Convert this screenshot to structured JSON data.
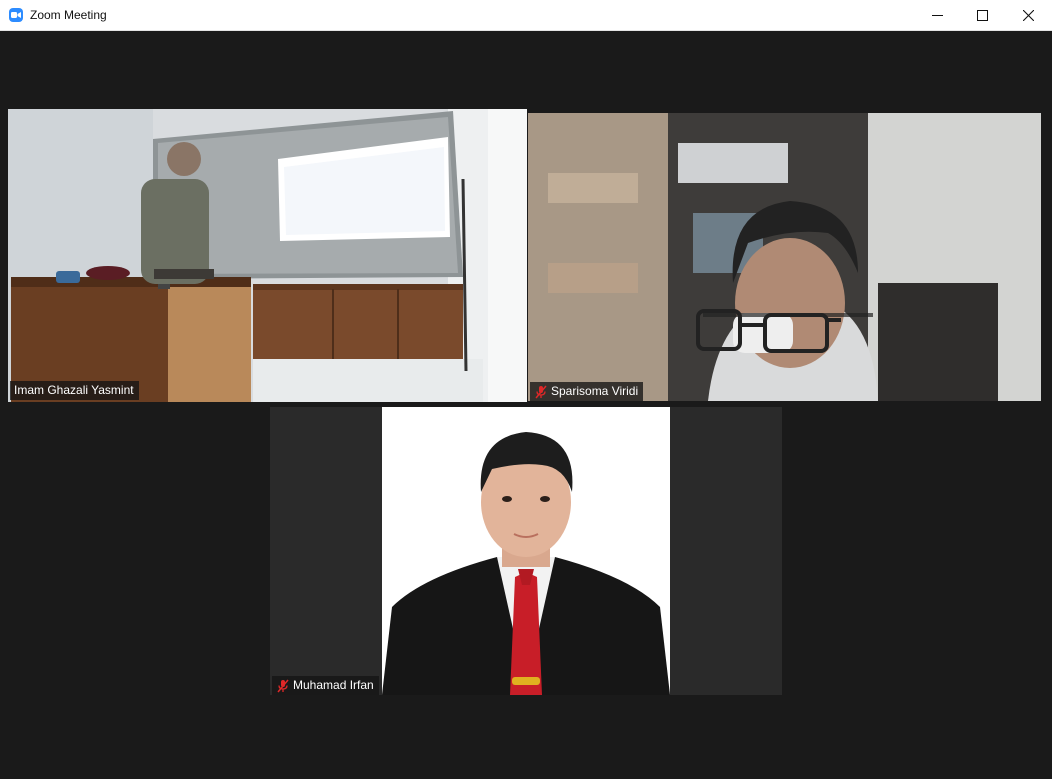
{
  "window": {
    "title": "Zoom Meeting",
    "app_icon": "zoom-icon",
    "controls": [
      "minimize-icon",
      "maximize-icon",
      "close-icon"
    ]
  },
  "colors": {
    "active_speaker_border": "#dfee8a",
    "background": "#1a1a1a",
    "mute_icon": "#e02828"
  },
  "participants": [
    {
      "name": "Imam Ghazali Yasmint",
      "muted": false,
      "active_speaker": true
    },
    {
      "name": "Sparisoma Viridi",
      "muted": true,
      "active_speaker": false
    },
    {
      "name": "Muhamad Irfan",
      "muted": true,
      "active_speaker": false
    }
  ]
}
